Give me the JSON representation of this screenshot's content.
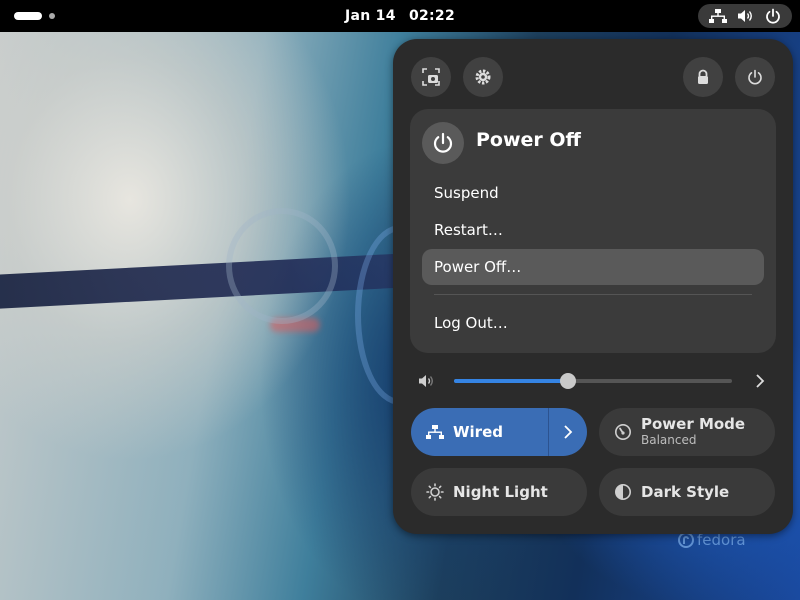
{
  "topbar": {
    "date": "Jan 14",
    "time": "02:22"
  },
  "status_icons": [
    "network-wired-icon",
    "volume-icon",
    "power-icon"
  ],
  "panel": {
    "header_buttons": [
      "screenshot-icon",
      "settings-icon",
      "lock-icon",
      "power-icon"
    ],
    "power_menu": {
      "title": "Power Off",
      "items": [
        "Suspend",
        "Restart…",
        "Power Off…",
        "Log Out…"
      ],
      "highlighted": "Power Off…"
    },
    "volume": {
      "level": 0.41
    },
    "toggles": {
      "wired": {
        "label": "Wired",
        "active": true
      },
      "power_mode": {
        "label": "Power Mode",
        "subtitle": "Balanced",
        "active": false
      },
      "night_light": {
        "label": "Night Light",
        "active": false
      },
      "dark_style": {
        "label": "Dark Style",
        "active": false
      }
    }
  },
  "watermark": "fedora",
  "colors": {
    "accent": "#3584e4",
    "toggle_on": "#3a6db5",
    "panel_bg": "#2b2b2b"
  }
}
